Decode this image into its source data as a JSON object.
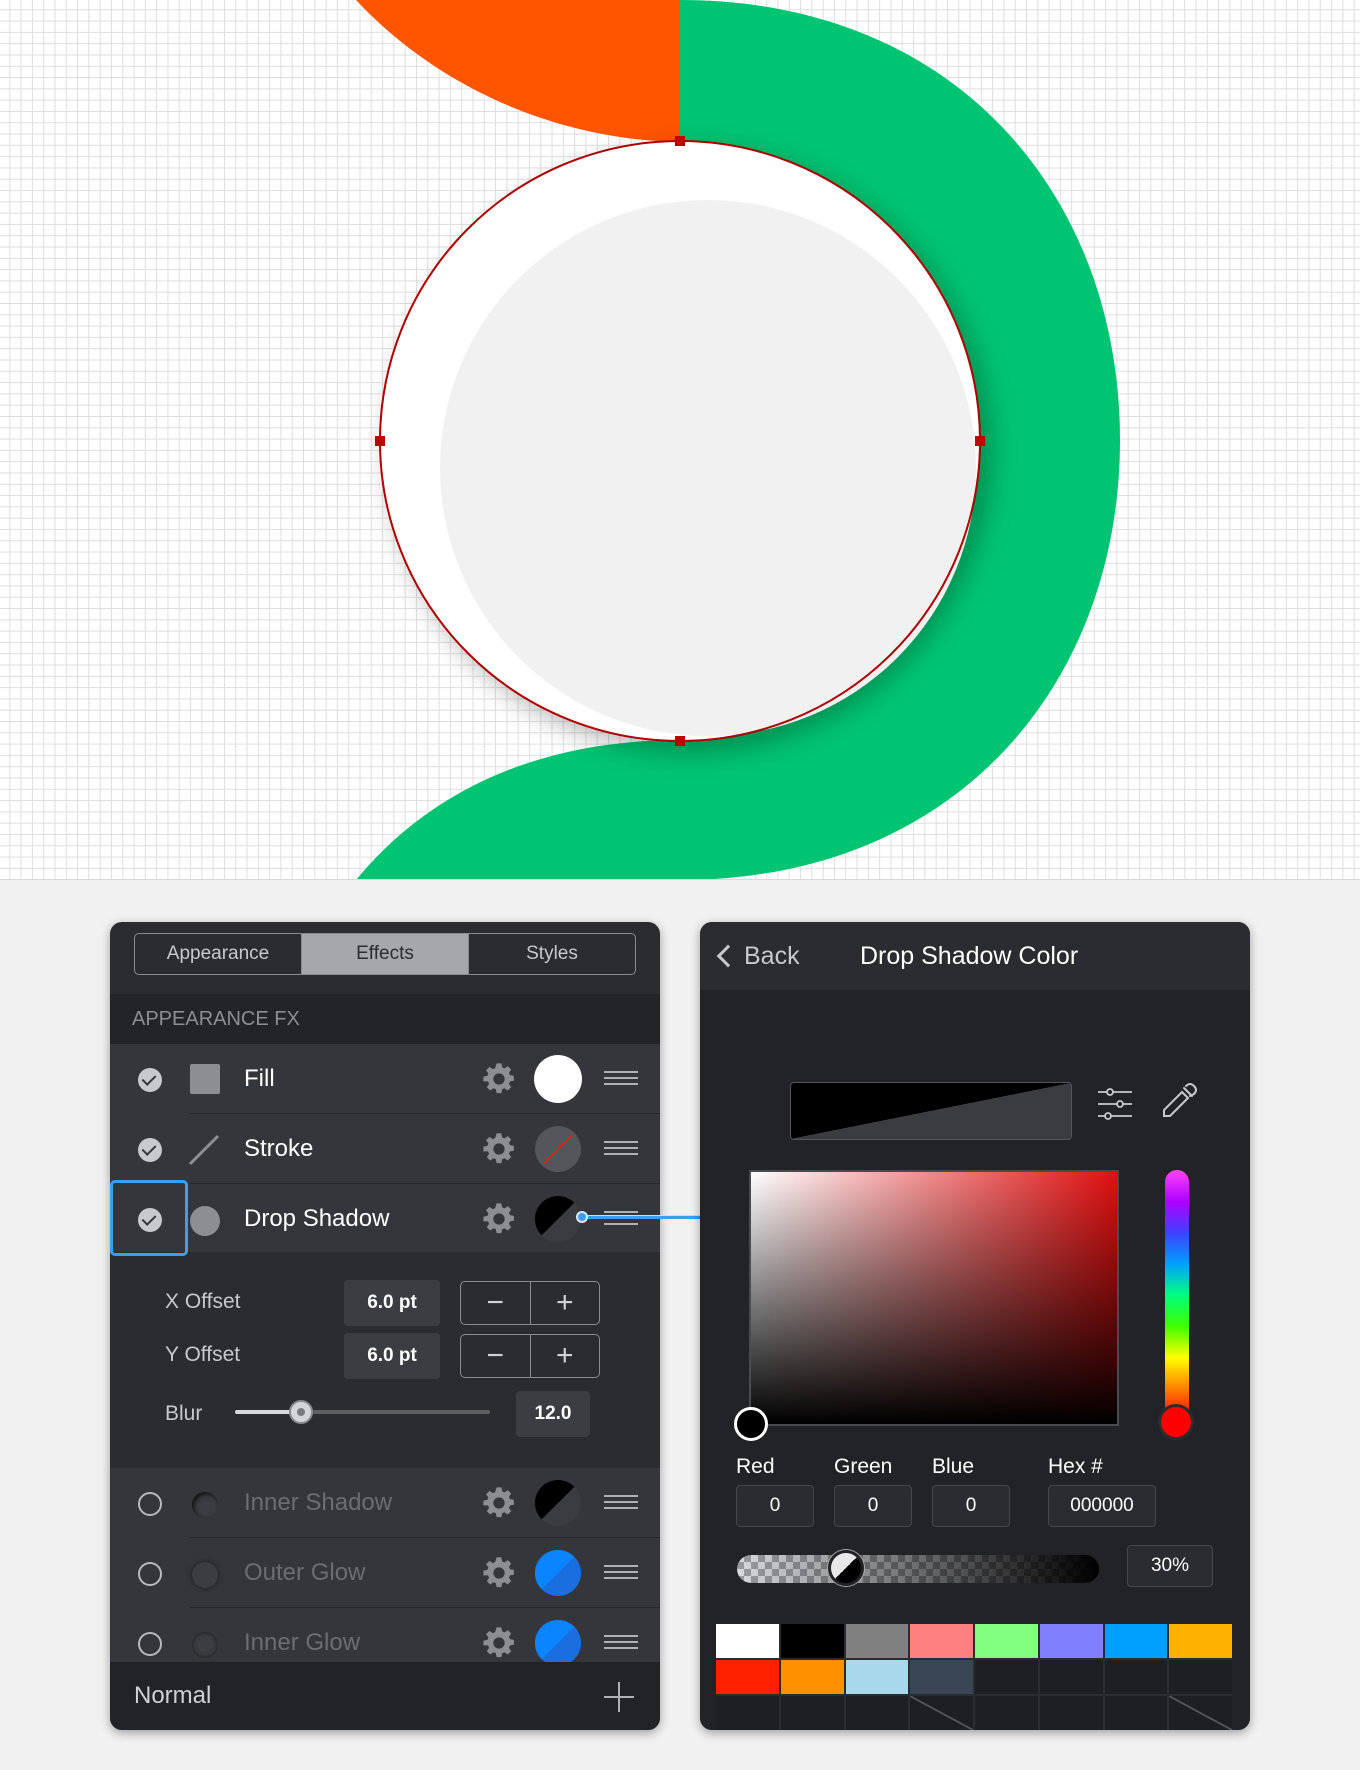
{
  "appearance_panel": {
    "tabs": [
      {
        "label": "Appearance",
        "active": false
      },
      {
        "label": "Effects",
        "active": true
      },
      {
        "label": "Styles",
        "active": false
      }
    ],
    "section_header": "APPEARANCE FX",
    "effects": [
      {
        "label": "Fill",
        "enabled": true,
        "icon": "square-fill-icon",
        "swatch": "#ffffff"
      },
      {
        "label": "Stroke",
        "enabled": true,
        "icon": "stroke-line-icon",
        "swatch": "none"
      },
      {
        "label": "Drop Shadow",
        "enabled": true,
        "icon": "circle-shadow-icon",
        "swatch": "#000000"
      },
      {
        "label": "Inner Shadow",
        "enabled": false,
        "icon": "circle-shadow-icon",
        "swatch": "#000000"
      },
      {
        "label": "Outer Glow",
        "enabled": false,
        "icon": "circle-glow-icon",
        "swatch": "#0a84ff"
      },
      {
        "label": "Inner Glow",
        "enabled": false,
        "icon": "circle-glow-icon",
        "swatch": "#0a84ff"
      }
    ],
    "drop_shadow_settings": {
      "x_offset_label": "X Offset",
      "x_offset_value": "6.0 pt",
      "y_offset_label": "Y Offset",
      "y_offset_value": "6.0 pt",
      "blur_label": "Blur",
      "blur_value": "12.0",
      "blur_fraction": 0.26
    },
    "blend_mode": "Normal"
  },
  "color_panel": {
    "back_label": "Back",
    "title": "Drop Shadow Color",
    "red_label": "Red",
    "green_label": "Green",
    "blue_label": "Blue",
    "hex_label": "Hex #",
    "red_value": "0",
    "green_value": "0",
    "blue_value": "0",
    "hex_value": "000000",
    "opacity_value": "30%",
    "opacity_fraction": 0.3,
    "palette": [
      "#ffffff",
      "#000000",
      "#808080",
      "#ff8080",
      "#80ff80",
      "#8080ff",
      "#00a0ff",
      "#ffb000",
      "#ff2000",
      "#ff9000",
      "#a8d8ea",
      "#3a4555",
      "",
      "",
      "",
      "",
      "",
      "",
      "",
      "slash",
      "",
      "",
      "",
      "slash"
    ]
  },
  "colors": {
    "green_shape": "#00c471",
    "orange_shape": "#ff5500",
    "selection_stroke": "#b00000",
    "accent": "#3a9ff0"
  }
}
